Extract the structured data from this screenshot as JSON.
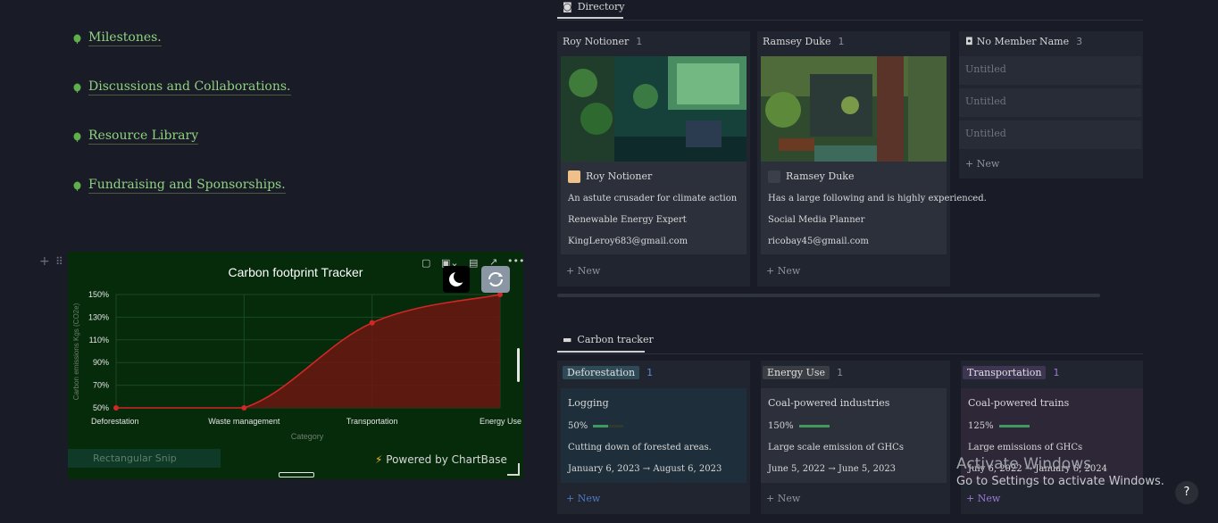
{
  "bullets": [
    {
      "label": "Milestones."
    },
    {
      "label": "Discussions and Collaborations."
    },
    {
      "label": "Resource Library"
    },
    {
      "label": "Fundraising and Sponsorships."
    }
  ],
  "chart_widget": {
    "powered_by": "Powered by ChartBase",
    "snip_label": "Rectangular Snip"
  },
  "chart_data": {
    "type": "area",
    "title": "Carbon footprint Tracker",
    "xlabel": "Category",
    "ylabel": "Carbon emissions Kgs (CO2e)",
    "categories": [
      "Deforestation",
      "Waste management",
      "Transportation",
      "Energy Use"
    ],
    "values": [
      50,
      50,
      125,
      150
    ],
    "yticks": [
      "50%",
      "70%",
      "90%",
      "110%",
      "130%",
      "150%"
    ],
    "ylim": [
      50,
      150
    ],
    "colors": {
      "line": "#d42626",
      "fill": "#6b1612",
      "background": "#052b0a"
    },
    "grid": true
  },
  "directory": {
    "title": "Directory",
    "columns": [
      {
        "name": "Roy Notioner",
        "count": "1",
        "card": {
          "name": "Roy Notioner",
          "lines": [
            "An astute crusader for climate action",
            "Renewable Energy Expert",
            "KingLeroy683@gmail.com"
          ]
        },
        "new_label": "+ New"
      },
      {
        "name": "Ramsey Duke",
        "count": "1",
        "card": {
          "name": "Ramsey Duke",
          "lines": [
            "Has a large following and is highly experienced.",
            "Social Media Planner",
            "ricobay45@gmail.com"
          ]
        },
        "new_label": "+ New"
      },
      {
        "name": "No Member Name",
        "count": "3",
        "items": [
          "Untitled",
          "Untitled",
          "Untitled"
        ],
        "new_label": "+ New"
      }
    ]
  },
  "tracker": {
    "title": "Carbon tracker",
    "columns": [
      {
        "tag": "Deforestation",
        "count": "1",
        "tag_color": "#2e4a57",
        "card_color": "#1e2f3b",
        "count_color": "#5b8bd6",
        "card": {
          "title": "Logging",
          "percent": "50%",
          "progress": 0.5,
          "desc": "Cutting down of forested areas.",
          "dates": "January 6, 2023 → August 6, 2023"
        },
        "new_label": "+ New",
        "new_color": "#4e79c4"
      },
      {
        "tag": "Energy Use",
        "count": "1",
        "tag_color": "#3a3d44",
        "card_color": "#2b303b",
        "count_color": "#8a8f98",
        "card": {
          "title": "Coal-powered industries",
          "percent": "150%",
          "progress": 1.0,
          "desc": "Large scale emission of GHCs",
          "dates": "June 5, 2022 → June 5, 2023"
        },
        "new_label": "+ New",
        "new_color": "#8f939c"
      },
      {
        "tag": "Transportation",
        "count": "1",
        "tag_color": "#3e3552",
        "card_color": "#2e2738",
        "count_color": "#9b7bd6",
        "card": {
          "title": "Coal-powered trains",
          "percent": "125%",
          "progress": 1.0,
          "desc": "Large emissions of GHCs",
          "dates": "July 6, 2022 → January 6, 2024"
        },
        "new_label": "+ New",
        "new_color": "#9b7bd6"
      }
    ]
  },
  "watermark": {
    "line1": "Activate Windows",
    "line2": "Go to Settings to activate Windows."
  },
  "help_label": "?"
}
